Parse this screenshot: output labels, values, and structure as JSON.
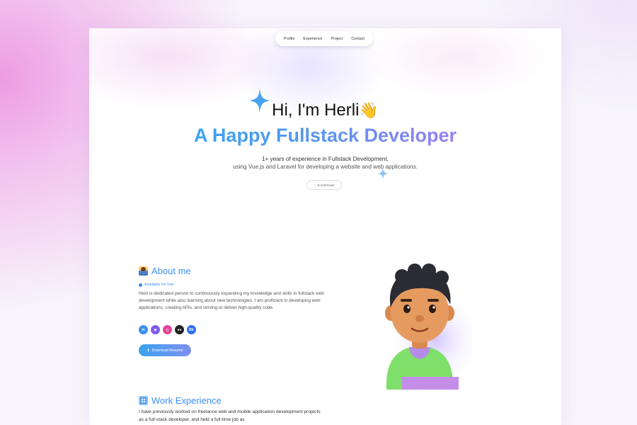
{
  "nav": {
    "items": [
      "Profile",
      "Experience",
      "Project",
      "Contact"
    ]
  },
  "hero": {
    "greeting": "Hi, I'm Herli",
    "wave_emoji": "👋",
    "title": "A Happy Fullstack Developer",
    "subtitle_line1": "1+ years of experience in Fullstack Development,",
    "subtitle_line2": "using Vue.js and Laravel for developing a website and web applications.",
    "scroll_label": "Scroll Down"
  },
  "about": {
    "title": "About me",
    "status": "Available for hire",
    "description": "Herli is dedicated person to continuously expanding my knowledge and skills in fullstack web development while also learning about new technologies. I am proficient in developing web applications, creating APIs, and striving to deliver high-quality code.",
    "socials": [
      {
        "icon": "linkedin-icon",
        "glyph": "in",
        "color": "#3d8ef0"
      },
      {
        "icon": "github-icon",
        "glyph": "◉",
        "color": "#7b5cf0"
      },
      {
        "icon": "instagram-icon",
        "glyph": "◎",
        "color": "#e0449b"
      },
      {
        "icon": "medium-icon",
        "glyph": "●●",
        "color": "#222222"
      },
      {
        "icon": "behance-icon",
        "glyph": "Bē",
        "color": "#2f6ff0"
      }
    ],
    "download_label": "Download Resume"
  },
  "work": {
    "title": "Work Experience",
    "description": "I have previously worked on freelance web and mobile application development projects as a full-stack developer, and held a full-time job as"
  },
  "colors": {
    "accent": "#3d8ef0",
    "gradient_start": "#3ba3ef",
    "gradient_end": "#9a7ff0",
    "page_glow": "#ee9be4"
  }
}
